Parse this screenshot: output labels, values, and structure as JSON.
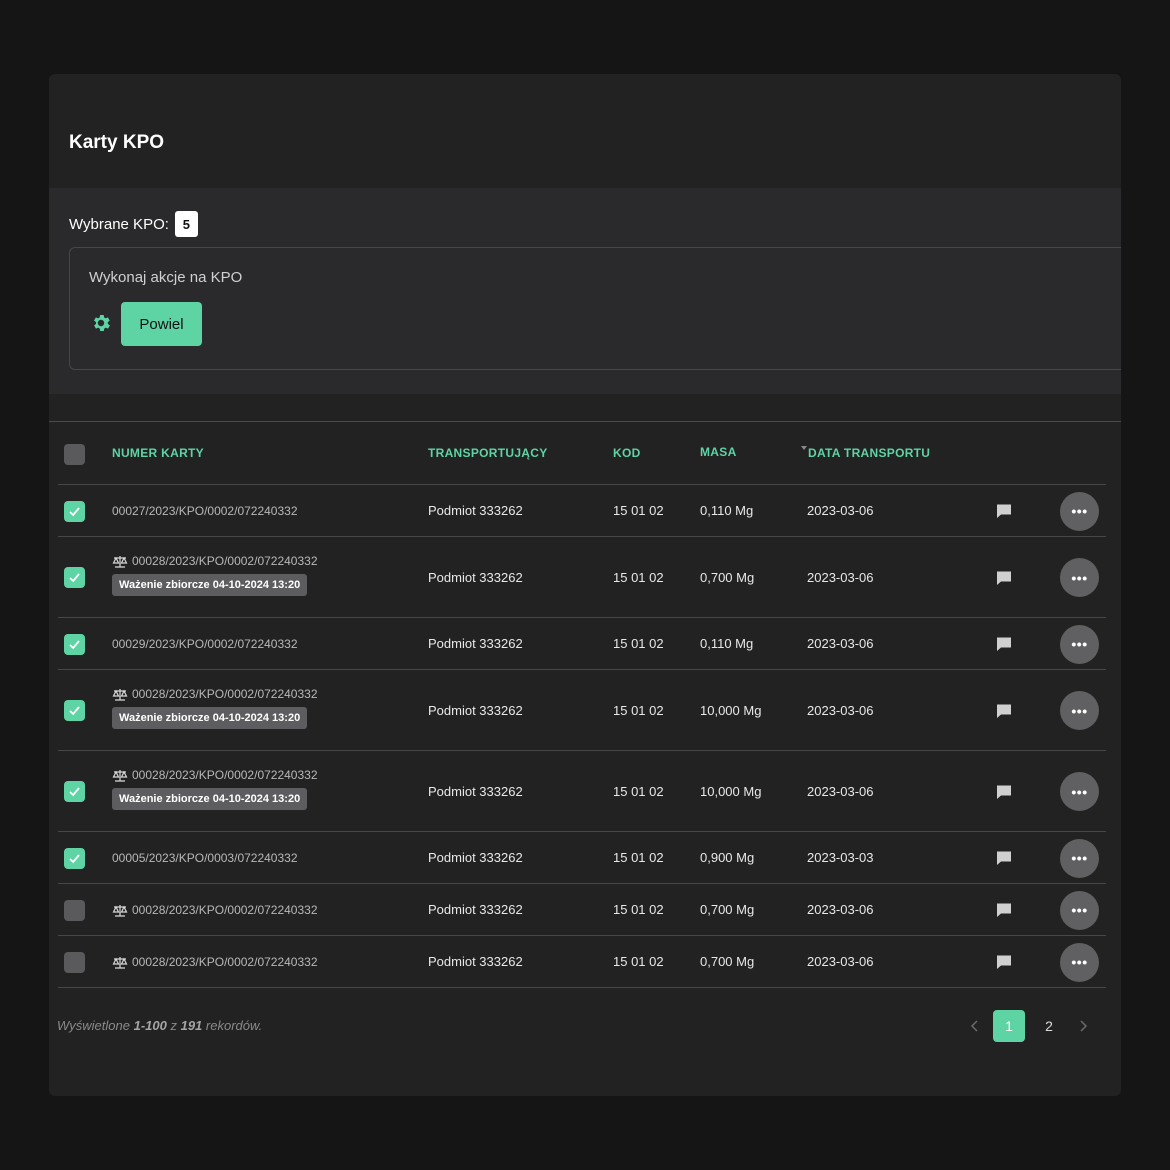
{
  "page": {
    "title": "Karty KPO"
  },
  "selection": {
    "label": "Wybrane KPO:",
    "count": "5",
    "actions_title": "Wykonaj akcje na KPO",
    "action_button": "Powiel"
  },
  "table": {
    "headers": {
      "number": "NUMER KARTY",
      "carrier": "TRANSPORTUJĄCY",
      "code": "KOD",
      "mass": "MASA",
      "date": "DATA TRANSPORTU"
    },
    "rows": [
      {
        "checked": true,
        "scale": false,
        "number": "00027/2023/KPO/0002/072240332",
        "tag": "",
        "carrier": "Podmiot 333262",
        "code": "15 01 02",
        "mass": "0,110 Mg",
        "date": "2023-03-06",
        "more": "•••"
      },
      {
        "checked": true,
        "scale": true,
        "number": "00028/2023/KPO/0002/072240332",
        "tag": "Ważenie zbiorcze 04-10-2024 13:20",
        "carrier": "Podmiot 333262",
        "code": "15 01 02",
        "mass": "0,700 Mg",
        "date": "2023-03-06",
        "more": "•••"
      },
      {
        "checked": true,
        "scale": false,
        "number": "00029/2023/KPO/0002/072240332",
        "tag": "",
        "carrier": "Podmiot 333262",
        "code": "15 01 02",
        "mass": "0,110 Mg",
        "date": "2023-03-06",
        "more": "•••"
      },
      {
        "checked": true,
        "scale": true,
        "number": "00028/2023/KPO/0002/072240332",
        "tag": "Ważenie zbiorcze 04-10-2024 13:20",
        "carrier": "Podmiot 333262",
        "code": "15 01 02",
        "mass": "10,000 Mg",
        "date": "2023-03-06",
        "more": "•••"
      },
      {
        "checked": true,
        "scale": true,
        "number": "00028/2023/KPO/0002/072240332",
        "tag": "Ważenie zbiorcze 04-10-2024 13:20",
        "carrier": "Podmiot 333262",
        "code": "15 01 02",
        "mass": "10,000 Mg",
        "date": "2023-03-06",
        "more": "•••"
      },
      {
        "checked": true,
        "scale": false,
        "number": "00005/2023/KPO/0003/072240332",
        "tag": "",
        "carrier": "Podmiot 333262",
        "code": "15 01 02",
        "mass": "0,900 Mg",
        "date": "2023-03-03",
        "more": "•••"
      },
      {
        "checked": false,
        "scale": true,
        "number": "00028/2023/KPO/0002/072240332",
        "tag": "",
        "carrier": "Podmiot 333262",
        "code": "15 01 02",
        "mass": "0,700 Mg",
        "date": "2023-03-06",
        "more": "•••"
      },
      {
        "checked": false,
        "scale": true,
        "number": "00028/2023/KPO/0002/072240332",
        "tag": "",
        "carrier": "Podmiot 333262",
        "code": "15 01 02",
        "mass": "0,700 Mg",
        "date": "2023-03-06",
        "more": "•••"
      }
    ]
  },
  "footer": {
    "prefix": "Wyświetlone",
    "range": "1-100",
    "of": "z",
    "total": "191",
    "suffix": "rekordów."
  },
  "pagination": {
    "pages": [
      "1",
      "2"
    ],
    "current": "1"
  },
  "colors": {
    "accent": "#5ed4a5",
    "background": "#151515",
    "card": "#222223"
  }
}
